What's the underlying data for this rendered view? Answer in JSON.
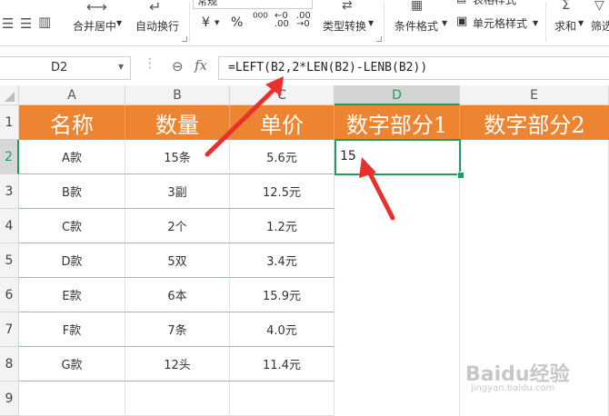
{
  "ribbon": {
    "merge_center": "合并居中",
    "wrap_text": "自动换行",
    "number_format": "常规",
    "currency_symbol": "¥",
    "percent_symbol": "%",
    "type_convert": "类型转换",
    "conditional_format": "条件格式",
    "cell_style": "单元格样式",
    "table_style": "表格样式",
    "sum": "求和",
    "filter": "筛选"
  },
  "formula_bar": {
    "cell_ref": "D2",
    "fx_label": "fx",
    "formula": "=LEFT(B2,2*LEN(B2)-LENB(B2))"
  },
  "columns": [
    "A",
    "B",
    "C",
    "D",
    "E"
  ],
  "rows": [
    "1",
    "2",
    "3",
    "4",
    "5",
    "6",
    "7",
    "8",
    "9"
  ],
  "header_row": [
    "名称",
    "数量",
    "单价",
    "数字部分1",
    "数字部分2"
  ],
  "data_rows": [
    [
      "A款",
      "15条",
      "5.6元"
    ],
    [
      "B款",
      "3副",
      "12.5元"
    ],
    [
      "C款",
      "2个",
      "1.2元"
    ],
    [
      "D款",
      "5双",
      "3.4元"
    ],
    [
      "E款",
      "6本",
      "15.9元"
    ],
    [
      "F款",
      "7条",
      "4.0元"
    ],
    [
      "G款",
      "12头",
      "11.4元"
    ]
  ],
  "active_cell": {
    "ref": "D2",
    "value": "15"
  },
  "watermark": {
    "brand": "Baidu经验",
    "url": "jingyan.baidu.com"
  },
  "colors": {
    "header_fill": "#EC8431",
    "selection": "#1E9E5E",
    "annotation_arrow": "#E8312F"
  }
}
